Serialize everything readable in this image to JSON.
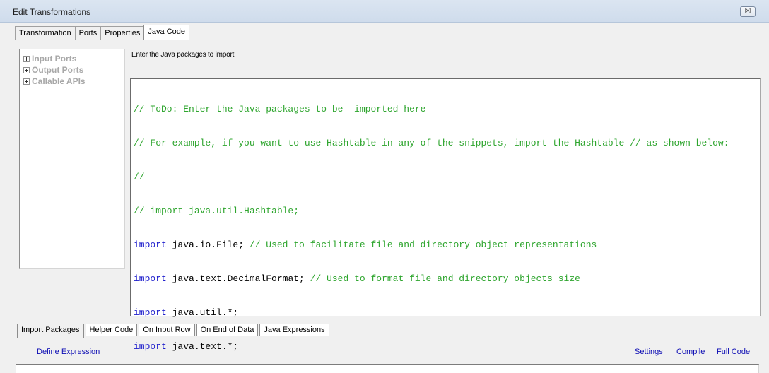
{
  "window": {
    "title": "Edit Transformations",
    "close_glyph": "☒"
  },
  "top_tabs": [
    {
      "label": "Transformation"
    },
    {
      "label": "Ports"
    },
    {
      "label": "Properties"
    },
    {
      "label": "Java Code"
    }
  ],
  "tree": {
    "items": [
      {
        "label": "Input Ports"
      },
      {
        "label": "Output Ports"
      },
      {
        "label": "Callable APIs"
      }
    ]
  },
  "description": "Enter the Java packages to import.",
  "code_lines": [
    {
      "keyword": "",
      "text": "",
      "comment": "// ToDo: Enter the Java packages to be  imported here"
    },
    {
      "keyword": "",
      "text": "",
      "comment": "// For example, if you want to use Hashtable in any of the snippets, import the Hashtable // as shown below:"
    },
    {
      "keyword": "",
      "text": "",
      "comment": "//"
    },
    {
      "keyword": "",
      "text": "",
      "comment": "// import java.util.Hashtable;"
    },
    {
      "keyword": "import",
      "text": " java.io.File; ",
      "comment": "// Used to facilitate file and directory object representations"
    },
    {
      "keyword": "import",
      "text": " java.text.DecimalFormat; ",
      "comment": "// Used to format file and directory objects size"
    },
    {
      "keyword": "import",
      "text": " java.util.*;",
      "comment": ""
    },
    {
      "keyword": "import",
      "text": " java.text.*;",
      "comment": ""
    }
  ],
  "bottom_tabs": [
    {
      "label": "Import Packages"
    },
    {
      "label": "Helper Code"
    },
    {
      "label": "On Input Row"
    },
    {
      "label": "On End of Data"
    },
    {
      "label": "Java Expressions"
    }
  ],
  "links": {
    "define_expression": "Define Expression",
    "settings": "Settings",
    "compile": "Compile",
    "full_code": "Full Code"
  },
  "colors": {
    "comment": "#2ea52e",
    "keyword": "#1c1ccc",
    "link": "#0c0cb4"
  }
}
